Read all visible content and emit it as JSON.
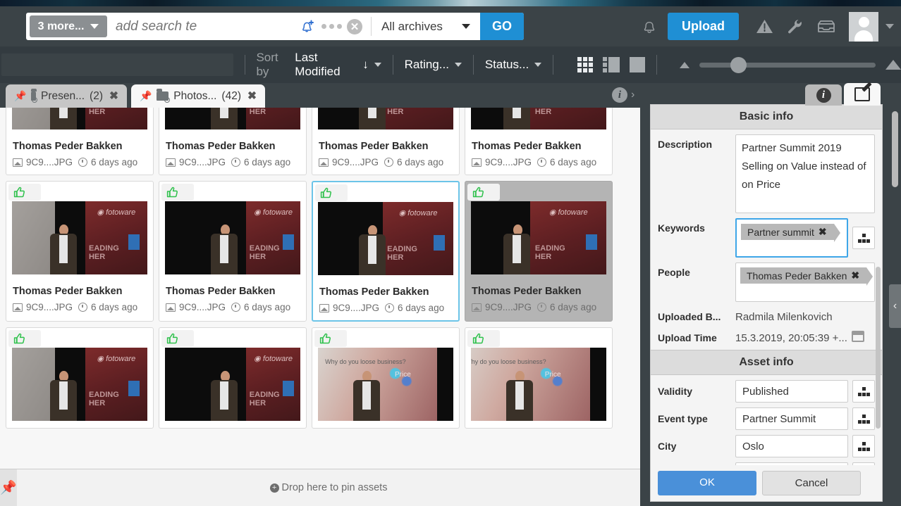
{
  "header": {
    "more_button_label": "3 more...",
    "search_placeholder": "add search te",
    "search_value": "",
    "archive_selector_value": "All archives",
    "go_button_label": "GO",
    "upload_button_label": "Upload",
    "icons": {
      "bell_add": "bell-plus-icon",
      "dots": "more-dots-icon",
      "clear": "clear-search-icon",
      "notifications": "bell-icon",
      "alerts": "warning-triangle-icon",
      "tools": "wrench-icon",
      "inbox": "inbox-icon",
      "avatar": "user-avatar-icon",
      "account_caret": "chevron-down-icon"
    }
  },
  "toolbar": {
    "sort_prefix": "Sort by",
    "sort_value": "Last Modified",
    "sort_direction_glyph": "↓",
    "rating_label": "Rating...",
    "status_label": "Status...",
    "view_modes": [
      "grid-view-icon",
      "split-view-icon",
      "single-view-icon"
    ],
    "zoom_slider_position_pct": 18
  },
  "tabs": [
    {
      "name": "Presen...",
      "count": "(2)",
      "active": false,
      "pinned": true
    },
    {
      "name": "Photos...",
      "count": "(42)",
      "active": true,
      "pinned": true
    }
  ],
  "grid": {
    "cards": [
      {
        "title": "Thomas Peder Bakken",
        "filename": "9C9....JPG",
        "time": "6 days ago",
        "row": 0,
        "kind": "speaker-a",
        "selected": false,
        "gray": false,
        "badges": false
      },
      {
        "title": "Thomas Peder Bakken",
        "filename": "9C9....JPG",
        "time": "6 days ago",
        "row": 0,
        "kind": "speaker-b",
        "selected": false,
        "gray": false,
        "badges": false
      },
      {
        "title": "Thomas Peder Bakken",
        "filename": "9C9....JPG",
        "time": "6 days ago",
        "row": 0,
        "kind": "speaker-c",
        "selected": false,
        "gray": false,
        "badges": false
      },
      {
        "title": "Thomas Peder Bakken",
        "filename": "9C9....JPG",
        "time": "6 days ago",
        "row": 0,
        "kind": "speaker-d",
        "selected": false,
        "gray": false,
        "badges": false
      },
      {
        "title": "Thomas Peder Bakken",
        "filename": "9C9....JPG",
        "time": "6 days ago",
        "row": 1,
        "kind": "speaker-a",
        "selected": false,
        "gray": false,
        "badges": true
      },
      {
        "title": "Thomas Peder Bakken",
        "filename": "9C9....JPG",
        "time": "6 days ago",
        "row": 1,
        "kind": "speaker-b",
        "selected": false,
        "gray": false,
        "badges": true
      },
      {
        "title": "Thomas Peder Bakken",
        "filename": "9C9....JPG",
        "time": "6 days ago",
        "row": 1,
        "kind": "speaker-c",
        "selected": true,
        "gray": false,
        "badges": true
      },
      {
        "title": "Thomas Peder Bakken",
        "filename": "9C9....JPG",
        "time": "6 days ago",
        "row": 1,
        "kind": "speaker-d",
        "selected": false,
        "gray": true,
        "badges": true
      },
      {
        "title": "",
        "filename": "",
        "time": "",
        "row": 2,
        "kind": "speaker-a",
        "selected": false,
        "gray": false,
        "badges": true
      },
      {
        "title": "",
        "filename": "",
        "time": "",
        "row": 2,
        "kind": "speaker-b",
        "selected": false,
        "gray": false,
        "badges": true
      },
      {
        "title": "",
        "filename": "",
        "time": "",
        "row": 2,
        "kind": "slide-a",
        "selected": false,
        "gray": false,
        "badges": true
      },
      {
        "title": "",
        "filename": "",
        "time": "",
        "row": 2,
        "kind": "slide-b",
        "selected": false,
        "gray": false,
        "badges": true
      }
    ],
    "badge_icons": [
      "thumbs-up-icon",
      "person-icon"
    ],
    "thumbnail_banner_text": "fotoware",
    "thumbnail_banner_line1": "EADING",
    "thumbnail_banner_line2": "HER",
    "slide_text": "Why do you loose business?",
    "slide_price_label": "Price"
  },
  "center_info": {
    "icon": "info-circle-icon",
    "chevron": "›"
  },
  "panel": {
    "tabs": [
      {
        "icon": "info-circle-icon",
        "selected": false
      },
      {
        "icon": "edit-pencil-icon",
        "selected": true
      }
    ],
    "sections": [
      {
        "heading": "Basic info",
        "fields": [
          {
            "label": "Description",
            "type": "textarea",
            "value": "Partner Summit 2019 Selling on Value instead of on Price"
          },
          {
            "label": "Keywords",
            "type": "tags",
            "tags": [
              "Partner summit"
            ],
            "focused": true,
            "tree_button": true
          },
          {
            "label": "People",
            "type": "tags",
            "tags": [
              "Thomas Peder Bakken"
            ],
            "focused": false,
            "tree_button": false
          },
          {
            "label": "Uploaded B...",
            "type": "static",
            "value": "Radmila Milenkovich"
          },
          {
            "label": "Upload Time",
            "type": "static-date",
            "value": "15.3.2019, 20:05:39 +...",
            "icon": "calendar-icon"
          }
        ]
      },
      {
        "heading": "Asset info",
        "fields": [
          {
            "label": "Validity",
            "type": "input",
            "value": "Published",
            "tree_button": true
          },
          {
            "label": "Event type",
            "type": "input",
            "value": "Partner Summit",
            "tree_button": true
          },
          {
            "label": "City",
            "type": "input",
            "value": "Oslo",
            "tree_button": true
          },
          {
            "label": "",
            "type": "input",
            "value": "",
            "tree_button": true
          }
        ]
      }
    ],
    "ok_label": "OK",
    "cancel_label": "Cancel",
    "collapse_handle": "‹"
  },
  "pinbar": {
    "message": "Drop here to pin assets",
    "pin_icon": "pushpin-icon",
    "plus_icon": "plus-circle-icon"
  }
}
